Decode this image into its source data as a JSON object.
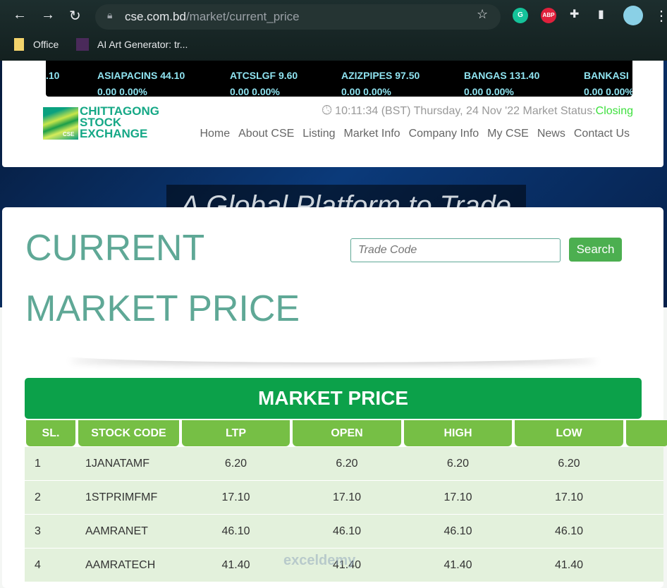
{
  "browser": {
    "url_domain": "cse.com.bd",
    "url_path": "/market/current_price",
    "bookmarks": [
      "Office",
      "AI Art Generator: tr..."
    ],
    "extensions": [
      "G",
      "ABP"
    ]
  },
  "ticker": [
    {
      "code": ".10",
      "change": ""
    },
    {
      "code": "ASIAPACINS 44.10",
      "change": "0.00  0.00%"
    },
    {
      "code": "ATCSLGF 9.60",
      "change": "0.00  0.00%"
    },
    {
      "code": "AZIZPIPES 97.50",
      "change": "0.00  0.00%"
    },
    {
      "code": "BANGAS 131.40",
      "change": "0.00  0.00%"
    },
    {
      "code": "BANKASI",
      "change": "0.00  0.00%"
    }
  ],
  "logo": {
    "line1": "CHITTAGONG",
    "line2": "STOCK",
    "line3": "EXCHANGE",
    "badge": "CSE"
  },
  "status": {
    "time": "10:11:34 (BST)",
    "date": "Thursday, 24 Nov '22",
    "label": "Market Status:",
    "value": "Closing"
  },
  "menu": [
    "Home",
    "About CSE",
    "Listing",
    "Market Info",
    "Company Info",
    "My CSE",
    "News",
    "Contact Us"
  ],
  "banner": "A Global Platform to Trade",
  "page": {
    "title1": "CURRENT",
    "title2": "MARKET PRICE",
    "search_placeholder": "Trade Code",
    "search_button": "Search",
    "table_title": "MARKET PRICE"
  },
  "table": {
    "headers": [
      "SL.",
      "STOCK CODE",
      "LTP",
      "OPEN",
      "HIGH",
      "LOW",
      ""
    ],
    "rows": [
      [
        "1",
        "1JANATAMF",
        "6.20",
        "6.20",
        "6.20",
        "6.20"
      ],
      [
        "2",
        "1STPRIMFMF",
        "17.10",
        "17.10",
        "17.10",
        "17.10"
      ],
      [
        "3",
        "AAMRANET",
        "46.10",
        "46.10",
        "46.10",
        "46.10"
      ],
      [
        "4",
        "AAMRATECH",
        "41.40",
        "41.40",
        "41.40",
        "41.40"
      ]
    ]
  },
  "watermark": "exceldemy"
}
